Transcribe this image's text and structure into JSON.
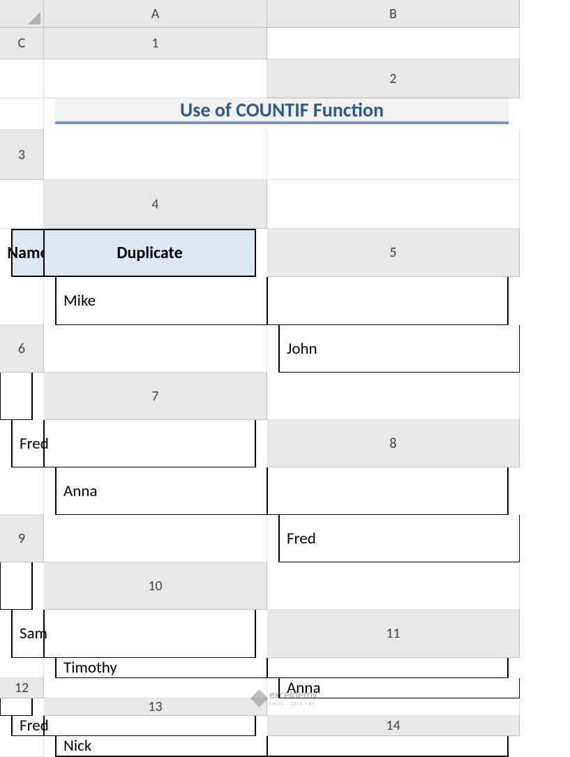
{
  "columns": [
    "A",
    "B",
    "C"
  ],
  "rows": [
    "1",
    "2",
    "3",
    "4",
    "5",
    "6",
    "7",
    "8",
    "9",
    "10",
    "11",
    "12",
    "13",
    "14"
  ],
  "title": "Use of COUNTIF Function",
  "table": {
    "headers": {
      "name": "Name",
      "duplicate": "Duplicate"
    },
    "data": [
      {
        "name": "Mike",
        "duplicate": ""
      },
      {
        "name": "John",
        "duplicate": ""
      },
      {
        "name": "Fred",
        "duplicate": ""
      },
      {
        "name": "Anna",
        "duplicate": ""
      },
      {
        "name": "Fred",
        "duplicate": ""
      },
      {
        "name": "Sam",
        "duplicate": ""
      },
      {
        "name": "Timothy",
        "duplicate": ""
      },
      {
        "name": "Anna",
        "duplicate": ""
      },
      {
        "name": "Fred",
        "duplicate": ""
      },
      {
        "name": "Nick",
        "duplicate": ""
      }
    ]
  },
  "watermark": {
    "main": "exceldemy",
    "sub": "EXCEL · DATA · BI"
  }
}
